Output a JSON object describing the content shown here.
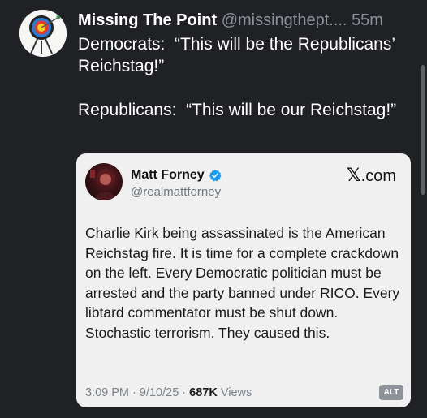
{
  "post": {
    "author_name": "Missing The Point",
    "author_handle": "@missingthept....",
    "time_ago": "55m",
    "avatar_icon": "archery-target-icon",
    "text": "Democrats:  “This will be the Republicans’ Reichstag!”\n\nRepublicans:  “This will be our Reichstag!”"
  },
  "quote": {
    "author_name": "Matt Forney",
    "author_handle": "@realmattforney",
    "verified_icon": "verified-badge-icon",
    "domain_mark": "𝕏",
    "domain_suffix": ".com",
    "body": "Charlie Kirk being assassinated is the American Reichstag fire. It is time for a complete crackdown on the left. Every Democratic politician must be arrested and the party banned under RICO. Every libtard commentator must be shut down. Stochastic terrorism. They caused this.",
    "timestamp": "3:09 PM · 9/10/25 · ",
    "views_count": "687K",
    "views_label": " Views",
    "alt_badge": "ALT"
  },
  "colors": {
    "background": "#202124",
    "card": "#f0f0f0",
    "verified": "#1d9bf0",
    "muted": "#8b939b"
  }
}
